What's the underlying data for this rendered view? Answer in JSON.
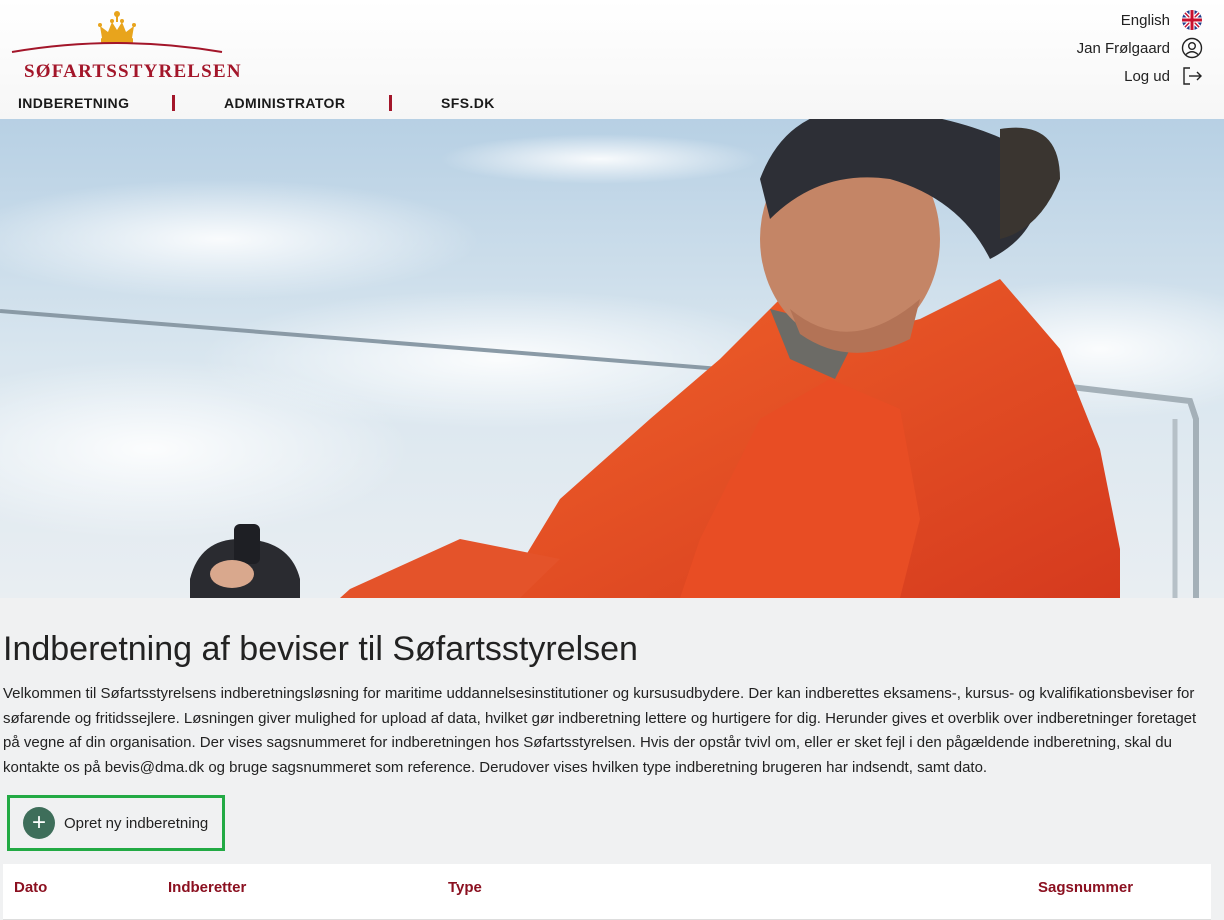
{
  "brand": {
    "name": "SØFARTSSTYRELSEN",
    "accent": "#a3162a",
    "crown_color": "#e8a41c"
  },
  "user_menu": {
    "language_label": "English",
    "language_icon": "uk-flag-icon",
    "user_name": "Jan Frølgaard",
    "user_icon": "user-circle-icon",
    "logout_label": "Log ud",
    "logout_icon": "logout-icon"
  },
  "nav": {
    "items": [
      {
        "label": "INDBERETNING"
      },
      {
        "label": "ADMINISTRATOR"
      },
      {
        "label": "SFS.DK"
      }
    ]
  },
  "main": {
    "title": "Indberetning af beviser til Søfartsstyrelsen",
    "intro": "Velkommen til Søfartsstyrelsens indberetningsløsning for maritime uddannelsesinstitutioner og kursusudbydere. Der kan indberettes eksamens-, kursus- og kvalifikationsbeviser for søfarende og fritidssejlere. Løsningen giver mulighed for upload af data, hvilket gør indberetning lettere og hurtigere for dig. Herunder gives et overblik over indberetninger foretaget på vegne af din organisation. Der vises sagsnummeret for indberetningen hos Søfartsstyrelsen. Hvis der opstår tvivl om, eller er sket fejl i den pågældende indberetning, skal du kontakte os på bevis@dma.dk og bruge sagsnummeret som reference. Derudover vises hvilken type indberetning brugeren har indsendt, samt dato.",
    "create_button": {
      "label": "Opret ny indberetning",
      "icon": "plus-icon",
      "color": "#3e6e5a",
      "highlight": "#22aa44"
    }
  },
  "table": {
    "columns": [
      "Dato",
      "Indberetter",
      "Type",
      "Sagsnummer"
    ],
    "header_color": "#8b1020"
  }
}
